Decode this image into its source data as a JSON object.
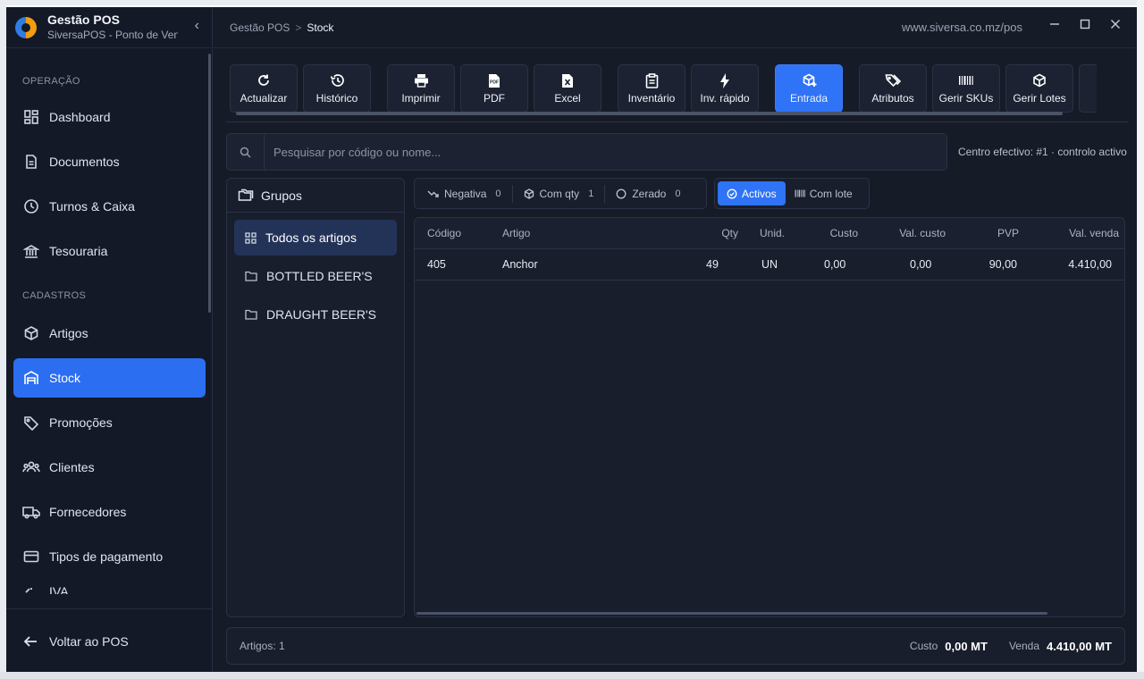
{
  "brand": {
    "title": "Gestão POS",
    "subtitle": "SiversaPOS - Ponto de Venda"
  },
  "sidebar": {
    "sections": [
      "OPERAÇÃO",
      "CADASTROS"
    ],
    "operacao": [
      {
        "label": "Dashboard",
        "icon": "dashboard-icon"
      },
      {
        "label": "Documentos",
        "icon": "document-icon"
      },
      {
        "label": "Turnos & Caixa",
        "icon": "clock-icon"
      },
      {
        "label": "Tesouraria",
        "icon": "bank-icon"
      }
    ],
    "cadastros": [
      {
        "label": "Artigos",
        "icon": "box-icon"
      },
      {
        "label": "Stock",
        "icon": "warehouse-icon",
        "active": true
      },
      {
        "label": "Promoções",
        "icon": "tag-icon"
      },
      {
        "label": "Clientes",
        "icon": "users-icon"
      },
      {
        "label": "Fornecedores",
        "icon": "truck-icon"
      },
      {
        "label": "Tipos de pagamento",
        "icon": "card-icon"
      },
      {
        "label": "IVA",
        "icon": "percent-icon"
      }
    ],
    "back_label": "Voltar ao POS"
  },
  "header": {
    "breadcrumb": [
      "Gestão POS",
      "Stock"
    ],
    "separator": ">",
    "url": "www.siversa.co.mz/pos"
  },
  "toolbar": [
    {
      "label": "Actualizar",
      "icon": "refresh-icon"
    },
    {
      "label": "Histórico",
      "icon": "history-icon"
    },
    {
      "label": "Imprimir",
      "icon": "printer-icon"
    },
    {
      "label": "PDF",
      "icon": "pdf-icon"
    },
    {
      "label": "Excel",
      "icon": "excel-icon"
    },
    {
      "label": "Inventário",
      "icon": "clipboard-icon"
    },
    {
      "label": "Inv. rápido",
      "icon": "bolt-icon"
    },
    {
      "label": "Entrada",
      "icon": "box-plus-icon",
      "primary": true
    },
    {
      "label": "Atributos",
      "icon": "tags-icon"
    },
    {
      "label": "Gerir SKUs",
      "icon": "barcode-icon"
    },
    {
      "label": "Gerir Lotes",
      "icon": "package-icon"
    }
  ],
  "search": {
    "placeholder": "Pesquisar por código ou nome...",
    "value": "",
    "centro": "Centro efectivo: #1 · controlo activo"
  },
  "groups": {
    "title": "Grupos",
    "items": [
      "Todos os artigos",
      "BOTTLED BEER'S",
      "DRAUGHT BEER'S"
    ]
  },
  "filters": [
    {
      "label": "Negativa",
      "count": "0",
      "icon": "trend-down-icon"
    },
    {
      "label": "Com qty",
      "count": "1",
      "icon": "box-icon"
    },
    {
      "label": "Zerado",
      "count": "0",
      "icon": "circle-icon"
    }
  ],
  "toggle": [
    {
      "label": "Activos",
      "icon": "check-circle-icon",
      "on": true
    },
    {
      "label": "Com lote",
      "icon": "barcode-icon"
    }
  ],
  "table": {
    "columns": [
      "Código",
      "Artigo",
      "Qty",
      "Unid.",
      "Custo",
      "Val. custo",
      "PVP",
      "Val. venda"
    ],
    "rows": [
      [
        "405",
        "Anchor",
        "49",
        "UN",
        "0,00",
        "0,00",
        "90,00",
        "4.410,00"
      ]
    ]
  },
  "footer": {
    "count": "Artigos: 1",
    "custo_label": "Custo",
    "custo_value": "0,00 MT",
    "venda_label": "Venda",
    "venda_value": "4.410,00 MT"
  },
  "colors": {
    "accent": "#2f73f6",
    "sidebar_active": "#2c6ef2",
    "background": "#161b28"
  }
}
